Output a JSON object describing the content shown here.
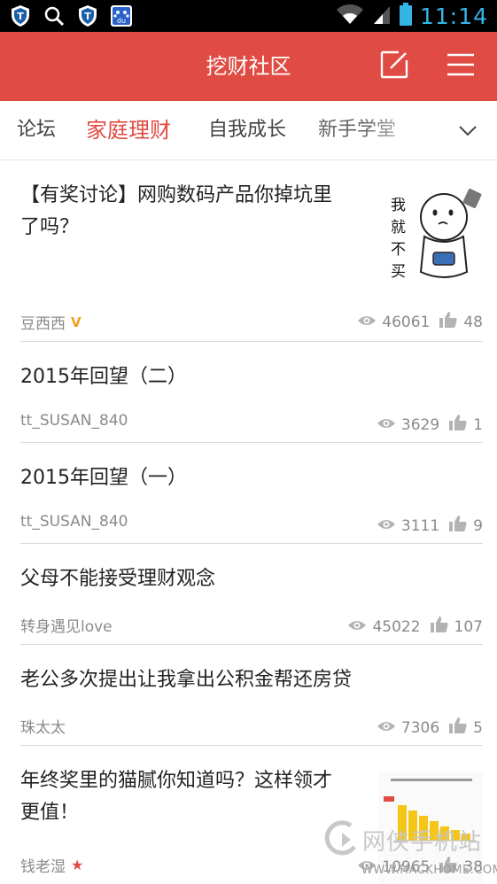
{
  "status_bar": {
    "time": "11:14",
    "left_icons": [
      "shield-icon",
      "search-icon",
      "shield-icon",
      "baidu-icon"
    ],
    "right_icons": [
      "wifi-icon",
      "signal-icon",
      "battery-icon"
    ]
  },
  "header": {
    "title": "挖财社区",
    "compose_icon": "compose-icon",
    "menu_icon": "menu-icon",
    "color": "#e04b43"
  },
  "tabs": {
    "items": [
      {
        "label": "论坛"
      },
      {
        "label": "家庭理财",
        "active": true
      },
      {
        "label": "自我成长"
      },
      {
        "label": "新手学堂"
      }
    ],
    "expand_icon": "chevron-down-icon"
  },
  "posts": [
    {
      "title": "【有奖讨论】网购数码产品你掉坑里了吗？",
      "author": "豆西西",
      "badge": "V",
      "views": "46061",
      "likes": "48",
      "thumb_text": "我就不买"
    },
    {
      "title": "2015年回望（二）",
      "author": "tt_SUSAN_840",
      "views": "3629",
      "likes": "1"
    },
    {
      "title": "2015年回望（一）",
      "author": "tt_SUSAN_840",
      "views": "3111",
      "likes": "9"
    },
    {
      "title": "父母不能接受理财观念",
      "author": "转身遇见love",
      "views": "45022",
      "likes": "107"
    },
    {
      "title": "老公多次提出让我拿出公积金帮还房贷",
      "author": "珠太太",
      "views": "7306",
      "likes": "5"
    },
    {
      "title": "年终奖里的猫腻你知道吗？这样领才更值！",
      "author": "钱老湿",
      "badge": "★",
      "views": "10965",
      "likes": "38"
    }
  ],
  "watermark": {
    "text": "网侠手机站",
    "url": "WWW.HACKHOME.COM"
  }
}
